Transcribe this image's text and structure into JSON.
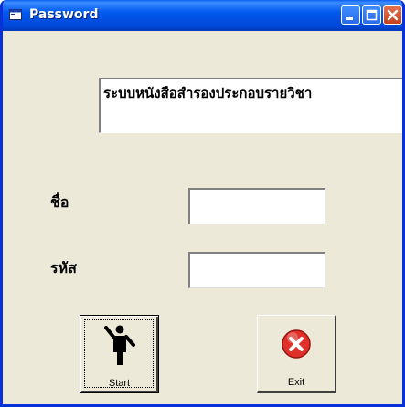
{
  "window": {
    "title": "Password",
    "title_icon": "vb-form-icon",
    "controls": [
      "minimize-icon",
      "maximize-icon",
      "close-icon"
    ]
  },
  "banner": {
    "text": "ระบบหนังสือสำรองประกอบรายวิชา"
  },
  "form": {
    "name_label": "ชื่อ",
    "name_value": "",
    "password_label": "รหัส",
    "password_value": ""
  },
  "buttons": {
    "start_label": "Start",
    "start_icon": "standing-person-icon",
    "exit_label": "Exit",
    "exit_icon": "red-x-icon"
  },
  "colors": {
    "titlebar": "#0058ee",
    "window_border": "#0831d9",
    "face": "#ece9d8",
    "exit_red": "#e0302a"
  }
}
